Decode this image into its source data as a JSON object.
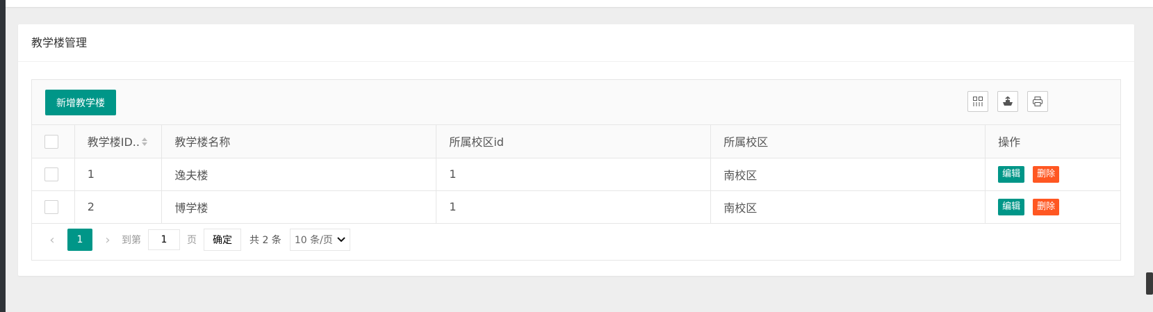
{
  "card": {
    "title": "教学楼管理"
  },
  "toolbar": {
    "add_button": "新增教学楼",
    "icons": [
      "columns-icon",
      "export-icon",
      "print-icon"
    ]
  },
  "table": {
    "headers": [
      "教学楼ID..",
      "教学楼名称",
      "所属校区id",
      "所属校区",
      "操作"
    ],
    "rows": [
      {
        "id": "1",
        "name": "逸夫楼",
        "campus_id": "1",
        "campus": "南校区",
        "edit": "编辑",
        "delete": "删除"
      },
      {
        "id": "2",
        "name": "博学楼",
        "campus_id": "1",
        "campus": "南校区",
        "edit": "编辑",
        "delete": "删除"
      }
    ]
  },
  "pager": {
    "current_page": "1",
    "goto_label": "到第",
    "goto_value": "1",
    "page_label": "页",
    "confirm": "确定",
    "total": "共 2 条",
    "page_size": "10 条/页"
  },
  "colors": {
    "primary": "#009688",
    "danger": "#ff5722"
  }
}
